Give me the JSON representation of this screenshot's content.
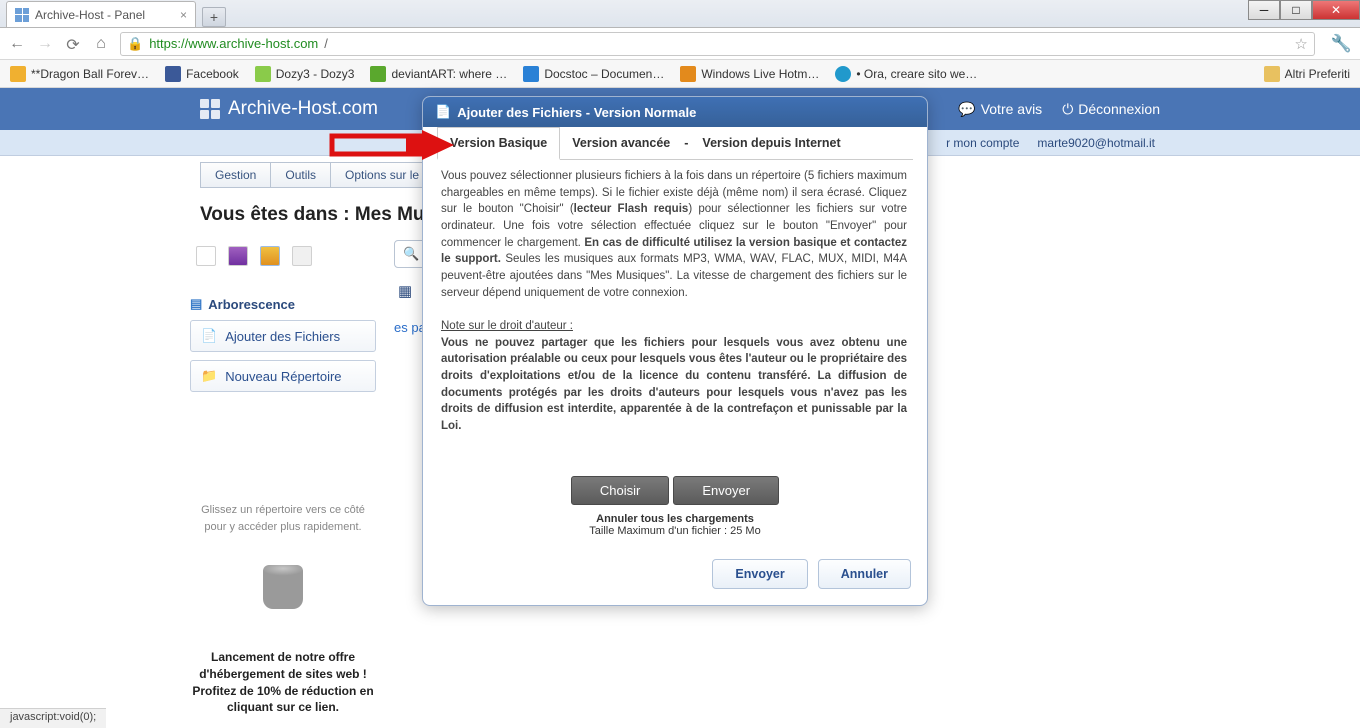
{
  "browser": {
    "tab_title": "Archive-Host - Panel",
    "url_scheme": "https://",
    "url_host": "www.archive-host.com",
    "url_path": "/",
    "bookmarks": [
      {
        "label": "**Dragon Ball Forev…"
      },
      {
        "label": "Facebook"
      },
      {
        "label": "Dozy3 - Dozy3"
      },
      {
        "label": "deviantART: where …"
      },
      {
        "label": "Docstoc – Documen…"
      },
      {
        "label": "Windows Live Hotm…"
      },
      {
        "label": "• Ora, creare sito we…"
      }
    ],
    "other_bookmarks": "Altri Preferiti",
    "status": "javascript:void(0);"
  },
  "header": {
    "brand": "Archive-Host.com",
    "avis": "Votre avis",
    "logout": "Déconnexion"
  },
  "subheader": {
    "account": "r mon compte",
    "email": "marte9020@hotmail.it"
  },
  "menu": {
    "tabs": [
      "Gestion",
      "Outils",
      "Options sur le Ré"
    ]
  },
  "breadcrumb": "Vous êtes dans : Mes Musi",
  "sidebar": {
    "tree": "Arborescence",
    "add_files": "Ajouter des Fichiers",
    "new_folder": "Nouveau Répertoire",
    "drop_hint": "Glissez un répertoire vers ce côté pour y accéder plus rapidement.",
    "promo": "Lancement de notre offre d'hébergement de sites web ! Profitez de 10% de réduction en cliquant sur ce lien."
  },
  "search": {
    "placeholder": "Rechercher"
  },
  "right": {
    "link": "es payantes"
  },
  "modal": {
    "title": "Ajouter des Fichiers - Version Normale",
    "version_tabs": {
      "basic": "Version Basique",
      "advanced": "Version avancée",
      "internet": "Version depuis Internet"
    },
    "body_p1_pre": "Vous pouvez sélectionner plusieurs fichiers à la fois dans un répertoire (5 fichiers maximum chargeables en même temps). Si le fichier existe déjà (même nom) il sera écrasé. Cliquez sur le bouton \"Choisir\" (",
    "body_p1_bold1": "lecteur Flash requis",
    "body_p1_mid": ") pour sélectionner les fichiers sur votre ordinateur. Une fois votre sélection effectuée cliquez sur le bouton \"Envoyer\" pour commencer le chargement. ",
    "body_p1_bold2": "En cas de difficulté utilisez la version basique et contactez le support.",
    "body_p1_post": " Seules les musiques aux formats MP3, WMA, WAV, FLAC, MUX, MIDI, M4A peuvent-être ajoutées dans \"Mes Musiques\". La vitesse de chargement des fichiers sur le serveur dépend uniquement de votre connexion.",
    "note_label": "Note sur le droit d'auteur :",
    "body_p2": "Vous ne pouvez partager que les fichiers pour lesquels vous avez obtenu une autorisation préalable ou ceux pour lesquels vous êtes l'auteur ou le propriétaire des droits d'exploitations et/ou de la licence du contenu transféré. La diffusion de documents protégés par les droits d'auteurs pour lesquels vous n'avez pas les droits de diffusion est interdite, apparentée à de la contrefaçon et punissable par la Loi.",
    "choose": "Choisir",
    "send_inner": "Envoyer",
    "cancel_all": "Annuler tous les chargements",
    "max_size": "Taille Maximum d'un fichier :  25 Mo",
    "send": "Envoyer",
    "cancel": "Annuler"
  }
}
